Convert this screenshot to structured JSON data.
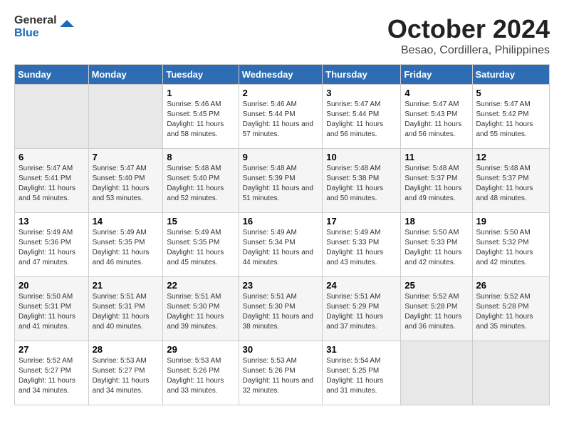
{
  "logo": {
    "line1": "General",
    "line2": "Blue"
  },
  "title": "October 2024",
  "subtitle": "Besao, Cordillera, Philippines",
  "weekdays": [
    "Sunday",
    "Monday",
    "Tuesday",
    "Wednesday",
    "Thursday",
    "Friday",
    "Saturday"
  ],
  "weeks": [
    [
      {
        "day": "",
        "empty": true
      },
      {
        "day": "",
        "empty": true
      },
      {
        "day": "1",
        "sunrise": "Sunrise: 5:46 AM",
        "sunset": "Sunset: 5:45 PM",
        "daylight": "Daylight: 11 hours and 58 minutes."
      },
      {
        "day": "2",
        "sunrise": "Sunrise: 5:46 AM",
        "sunset": "Sunset: 5:44 PM",
        "daylight": "Daylight: 11 hours and 57 minutes."
      },
      {
        "day": "3",
        "sunrise": "Sunrise: 5:47 AM",
        "sunset": "Sunset: 5:44 PM",
        "daylight": "Daylight: 11 hours and 56 minutes."
      },
      {
        "day": "4",
        "sunrise": "Sunrise: 5:47 AM",
        "sunset": "Sunset: 5:43 PM",
        "daylight": "Daylight: 11 hours and 56 minutes."
      },
      {
        "day": "5",
        "sunrise": "Sunrise: 5:47 AM",
        "sunset": "Sunset: 5:42 PM",
        "daylight": "Daylight: 11 hours and 55 minutes."
      }
    ],
    [
      {
        "day": "6",
        "sunrise": "Sunrise: 5:47 AM",
        "sunset": "Sunset: 5:41 PM",
        "daylight": "Daylight: 11 hours and 54 minutes."
      },
      {
        "day": "7",
        "sunrise": "Sunrise: 5:47 AM",
        "sunset": "Sunset: 5:40 PM",
        "daylight": "Daylight: 11 hours and 53 minutes."
      },
      {
        "day": "8",
        "sunrise": "Sunrise: 5:48 AM",
        "sunset": "Sunset: 5:40 PM",
        "daylight": "Daylight: 11 hours and 52 minutes."
      },
      {
        "day": "9",
        "sunrise": "Sunrise: 5:48 AM",
        "sunset": "Sunset: 5:39 PM",
        "daylight": "Daylight: 11 hours and 51 minutes."
      },
      {
        "day": "10",
        "sunrise": "Sunrise: 5:48 AM",
        "sunset": "Sunset: 5:38 PM",
        "daylight": "Daylight: 11 hours and 50 minutes."
      },
      {
        "day": "11",
        "sunrise": "Sunrise: 5:48 AM",
        "sunset": "Sunset: 5:37 PM",
        "daylight": "Daylight: 11 hours and 49 minutes."
      },
      {
        "day": "12",
        "sunrise": "Sunrise: 5:48 AM",
        "sunset": "Sunset: 5:37 PM",
        "daylight": "Daylight: 11 hours and 48 minutes."
      }
    ],
    [
      {
        "day": "13",
        "sunrise": "Sunrise: 5:49 AM",
        "sunset": "Sunset: 5:36 PM",
        "daylight": "Daylight: 11 hours and 47 minutes."
      },
      {
        "day": "14",
        "sunrise": "Sunrise: 5:49 AM",
        "sunset": "Sunset: 5:35 PM",
        "daylight": "Daylight: 11 hours and 46 minutes."
      },
      {
        "day": "15",
        "sunrise": "Sunrise: 5:49 AM",
        "sunset": "Sunset: 5:35 PM",
        "daylight": "Daylight: 11 hours and 45 minutes."
      },
      {
        "day": "16",
        "sunrise": "Sunrise: 5:49 AM",
        "sunset": "Sunset: 5:34 PM",
        "daylight": "Daylight: 11 hours and 44 minutes."
      },
      {
        "day": "17",
        "sunrise": "Sunrise: 5:49 AM",
        "sunset": "Sunset: 5:33 PM",
        "daylight": "Daylight: 11 hours and 43 minutes."
      },
      {
        "day": "18",
        "sunrise": "Sunrise: 5:50 AM",
        "sunset": "Sunset: 5:33 PM",
        "daylight": "Daylight: 11 hours and 42 minutes."
      },
      {
        "day": "19",
        "sunrise": "Sunrise: 5:50 AM",
        "sunset": "Sunset: 5:32 PM",
        "daylight": "Daylight: 11 hours and 42 minutes."
      }
    ],
    [
      {
        "day": "20",
        "sunrise": "Sunrise: 5:50 AM",
        "sunset": "Sunset: 5:31 PM",
        "daylight": "Daylight: 11 hours and 41 minutes."
      },
      {
        "day": "21",
        "sunrise": "Sunrise: 5:51 AM",
        "sunset": "Sunset: 5:31 PM",
        "daylight": "Daylight: 11 hours and 40 minutes."
      },
      {
        "day": "22",
        "sunrise": "Sunrise: 5:51 AM",
        "sunset": "Sunset: 5:30 PM",
        "daylight": "Daylight: 11 hours and 39 minutes."
      },
      {
        "day": "23",
        "sunrise": "Sunrise: 5:51 AM",
        "sunset": "Sunset: 5:30 PM",
        "daylight": "Daylight: 11 hours and 38 minutes."
      },
      {
        "day": "24",
        "sunrise": "Sunrise: 5:51 AM",
        "sunset": "Sunset: 5:29 PM",
        "daylight": "Daylight: 11 hours and 37 minutes."
      },
      {
        "day": "25",
        "sunrise": "Sunrise: 5:52 AM",
        "sunset": "Sunset: 5:28 PM",
        "daylight": "Daylight: 11 hours and 36 minutes."
      },
      {
        "day": "26",
        "sunrise": "Sunrise: 5:52 AM",
        "sunset": "Sunset: 5:28 PM",
        "daylight": "Daylight: 11 hours and 35 minutes."
      }
    ],
    [
      {
        "day": "27",
        "sunrise": "Sunrise: 5:52 AM",
        "sunset": "Sunset: 5:27 PM",
        "daylight": "Daylight: 11 hours and 34 minutes."
      },
      {
        "day": "28",
        "sunrise": "Sunrise: 5:53 AM",
        "sunset": "Sunset: 5:27 PM",
        "daylight": "Daylight: 11 hours and 34 minutes."
      },
      {
        "day": "29",
        "sunrise": "Sunrise: 5:53 AM",
        "sunset": "Sunset: 5:26 PM",
        "daylight": "Daylight: 11 hours and 33 minutes."
      },
      {
        "day": "30",
        "sunrise": "Sunrise: 5:53 AM",
        "sunset": "Sunset: 5:26 PM",
        "daylight": "Daylight: 11 hours and 32 minutes."
      },
      {
        "day": "31",
        "sunrise": "Sunrise: 5:54 AM",
        "sunset": "Sunset: 5:25 PM",
        "daylight": "Daylight: 11 hours and 31 minutes."
      },
      {
        "day": "",
        "empty": true
      },
      {
        "day": "",
        "empty": true
      }
    ]
  ]
}
